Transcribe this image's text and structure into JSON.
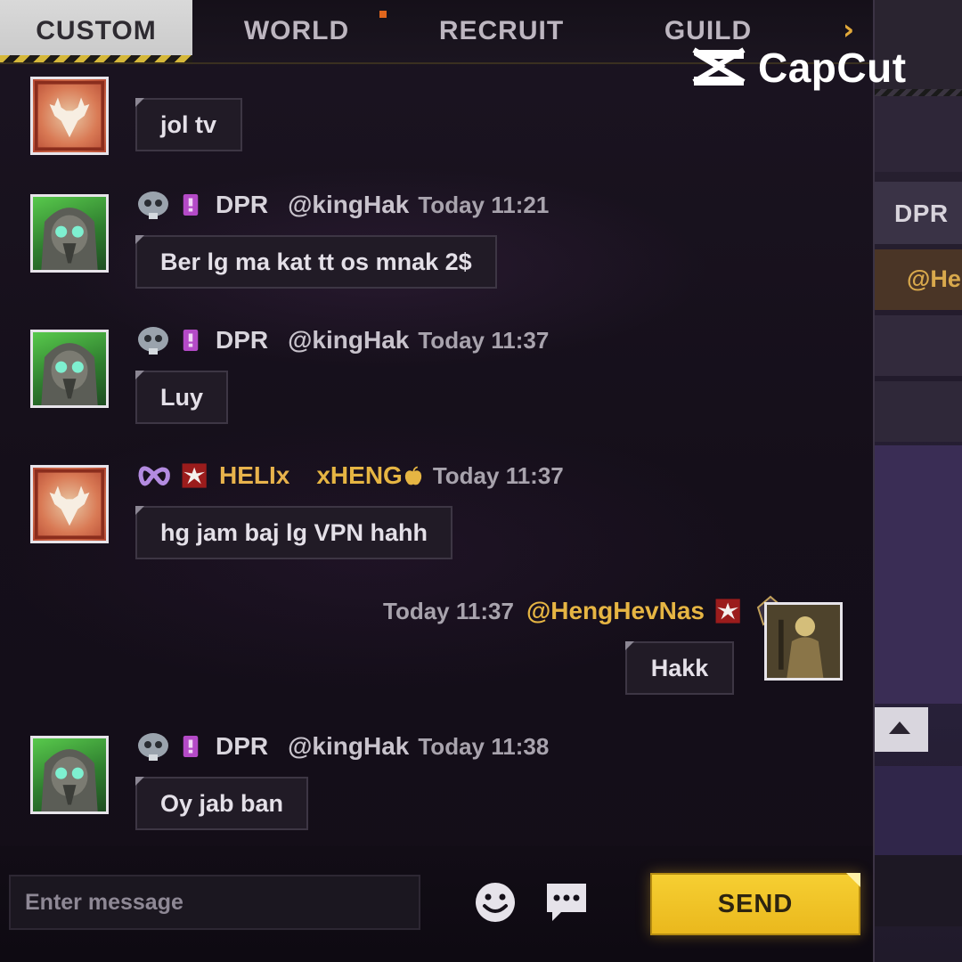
{
  "tabs": [
    {
      "label": "CUSTOM",
      "active": true
    },
    {
      "label": "WORLD",
      "active": false
    },
    {
      "label": "RECRUIT",
      "active": false
    },
    {
      "label": "GUILD",
      "active": false
    }
  ],
  "watermark": {
    "text": "CapCut"
  },
  "side_panel": {
    "clan_label": "DPR",
    "mention_preview": "@Her"
  },
  "messages": [
    {
      "avatar": "deer-avatar",
      "text": "jol tv"
    },
    {
      "avatar": "plague-mask-avatar",
      "clan": "DPR",
      "name": "@kingHak",
      "time": "Today 11:21",
      "text": "Ber lg ma kat tt os mnak 2$"
    },
    {
      "avatar": "plague-mask-avatar",
      "clan": "DPR",
      "name": "@kingHak",
      "time": "Today 11:37",
      "text": "Luy"
    },
    {
      "avatar": "deer-avatar",
      "clan": "HELIx",
      "name": "xHENG",
      "time": "Today 11:37",
      "text": "hg jam baj lg VPN hahh"
    },
    {
      "avatar": "gold-character-avatar",
      "own": true,
      "name": "@HengHevNas",
      "time": "Today 11:37",
      "text": "Hakk"
    },
    {
      "avatar": "plague-mask-avatar",
      "clan": "DPR",
      "name": "@kingHak",
      "time": "Today 11:38",
      "text": "Oy jab ban"
    }
  ],
  "input": {
    "placeholder": "Enter message",
    "value": ""
  },
  "send_label": "SEND",
  "colors": {
    "accent_yellow": "#f0c22a",
    "gold_name": "#e6b543",
    "background": "#17111d",
    "tab_active": "#d3d3d3"
  }
}
